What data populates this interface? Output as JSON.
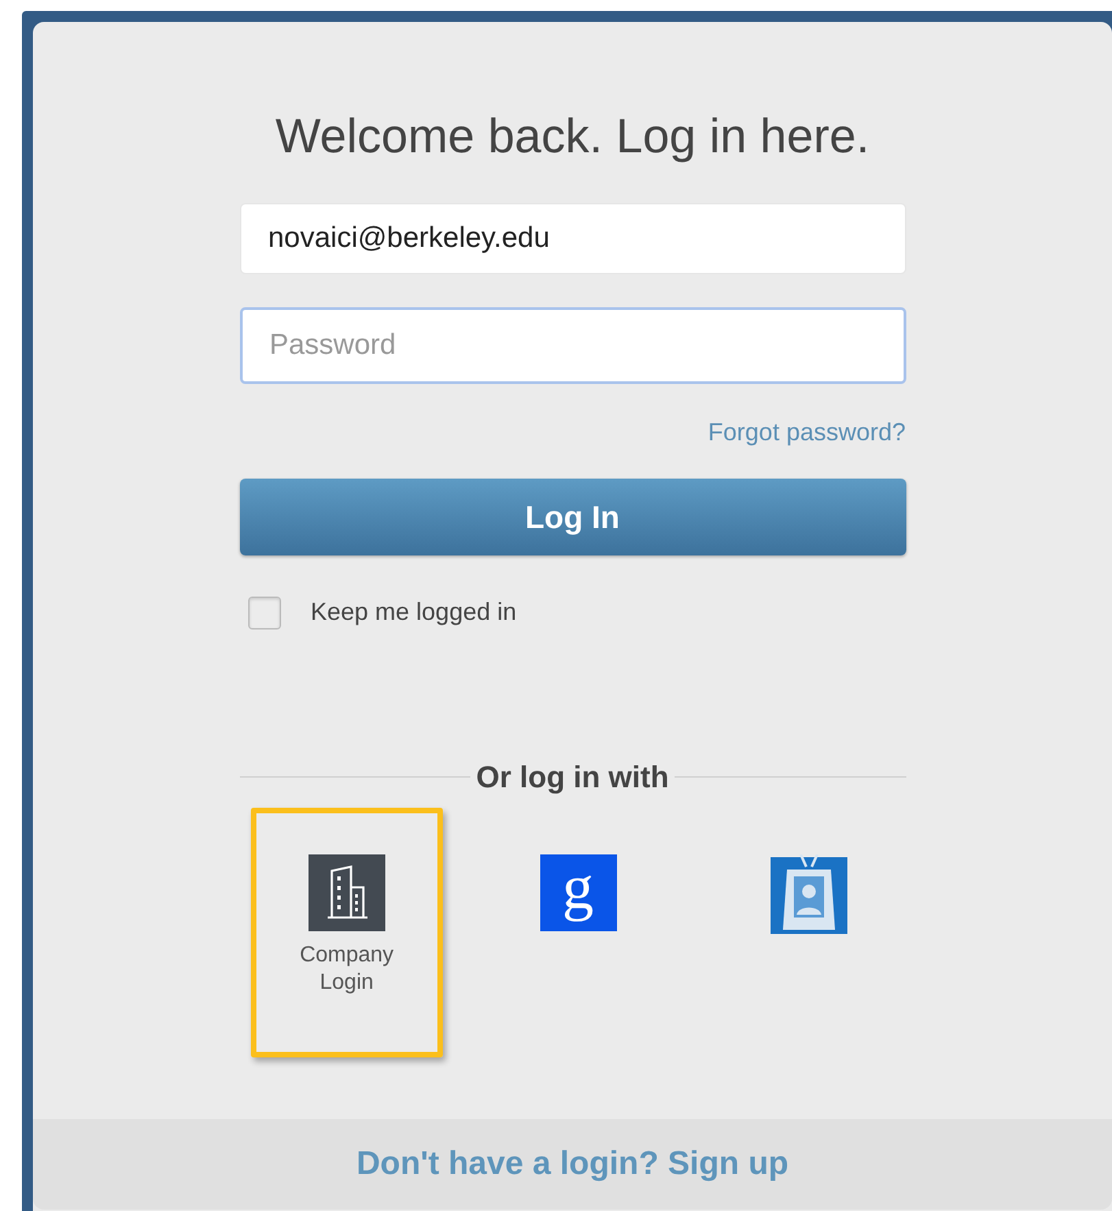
{
  "title": "Welcome back. Log in here.",
  "email_field": {
    "value": "novaici@berkeley.edu",
    "focused": false
  },
  "password_field": {
    "placeholder": "Password",
    "focused": true
  },
  "forgot_link": "Forgot password?",
  "login_button": "Log In",
  "keep_logged_in": {
    "label": "Keep me logged in",
    "checked": false
  },
  "divider_label": "Or log in with",
  "providers": [
    {
      "kind": "company",
      "label": "Company Login",
      "selected": true
    },
    {
      "kind": "google",
      "glyph": "g",
      "selected": false
    },
    {
      "kind": "badge",
      "selected": false
    }
  ],
  "footer": {
    "text": "Don't have a login?",
    "link": "Sign up"
  }
}
